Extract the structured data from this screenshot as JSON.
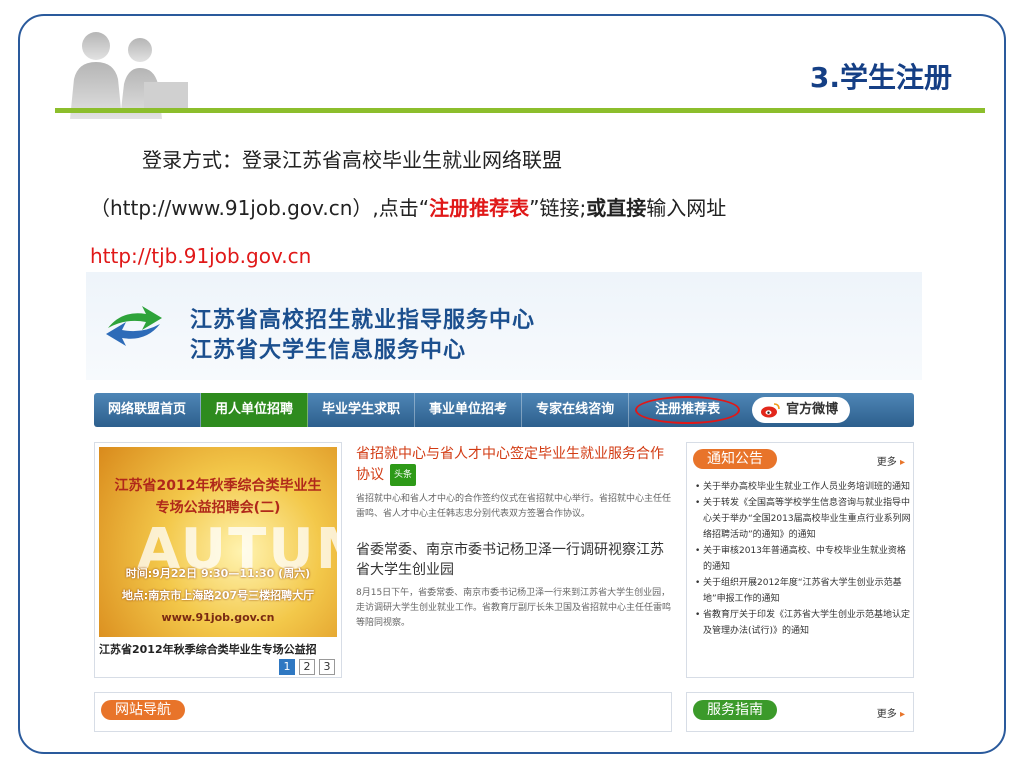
{
  "slide": {
    "title": "3.学生注册",
    "intro": {
      "line1": "登录方式：登录江苏省高校毕业生就业网络联盟",
      "line2_a": "（http://www.91job.gov.cn）,点击“",
      "line2_red": "注册推荐表",
      "line2_b": "”链接;",
      "line2_bold": "或直接",
      "line2_c": "输入网址",
      "line3_url": "http://tjb.91job.gov.cn"
    }
  },
  "site": {
    "title_line1": "江苏省高校招生就业指导服务中心",
    "title_line2": "江苏省大学生信息服务中心",
    "nav": [
      {
        "label": "网络联盟首页"
      },
      {
        "label": "用人单位招聘"
      },
      {
        "label": "毕业学生求职"
      },
      {
        "label": "事业单位招考"
      },
      {
        "label": "专家在线咨询"
      },
      {
        "label": "注册推荐表"
      }
    ],
    "weibo_label": "官方微博",
    "feature": {
      "img_line1": "江苏省2012年秋季综合类毕业生",
      "img_line2": "专场公益招聘会(二)",
      "img_autumn": "AUTUMN",
      "img_line3": "时间:9月22日 9:30—11:30 (周六)",
      "img_line4": "地点:南京市上海路207号三楼招聘大厅",
      "img_line5": "www.91job.gov.cn",
      "caption": "江苏省2012年秋季综合类毕业生专场公益招",
      "pages": [
        "1",
        "2",
        "3"
      ]
    },
    "news": [
      {
        "headline": "省招就中心与省人才中心签定毕业生就业服务合作协议",
        "tag": "头条",
        "summary": "省招就中心和省人才中心的合作签约仪式在省招就中心举行。省招就中心主任任雷鸣、省人才中心主任韩志忠分别代表双方签署合作协议。"
      },
      {
        "headline": "省委常委、南京市委书记杨卫泽一行调研视察江苏省大学生创业园",
        "summary": "8月15日下午，省委常委、南京市委书记杨卫泽一行来到江苏省大学生创业园，走访调研大学生创业就业工作。省教育厅副厅长朱卫国及省招就中心主任任雷鸣等陪同视察。"
      }
    ],
    "notice": {
      "title": "通知公告",
      "more": "更多",
      "items": [
        "关于举办高校毕业生就业工作人员业务培训班的通知",
        "关于转发《全国高等学校学生信息咨询与就业指导中心关于举办“全国2013届高校毕业生重点行业系列网络招聘活动”的通知》的通知",
        "关于审核2013年普通高校、中专校毕业生就业资格的通知",
        "关于组织开展2012年度“江苏省大学生创业示范基地”申报工作的通知",
        "省教育厅关于印发《江苏省大学生创业示范基地认定及管理办法(试行)》的通知"
      ]
    },
    "site_nav_title": "网站导航",
    "service_title": "服务指南",
    "service_more": "更多",
    "colors": {
      "frame": "#2a5a9c",
      "accent_green": "#8cbe2c",
      "title_blue": "#153f85",
      "highlight_red": "#e01818",
      "nav_blue": "#2d5f8d",
      "nav_active": "#2e8b1e"
    }
  }
}
